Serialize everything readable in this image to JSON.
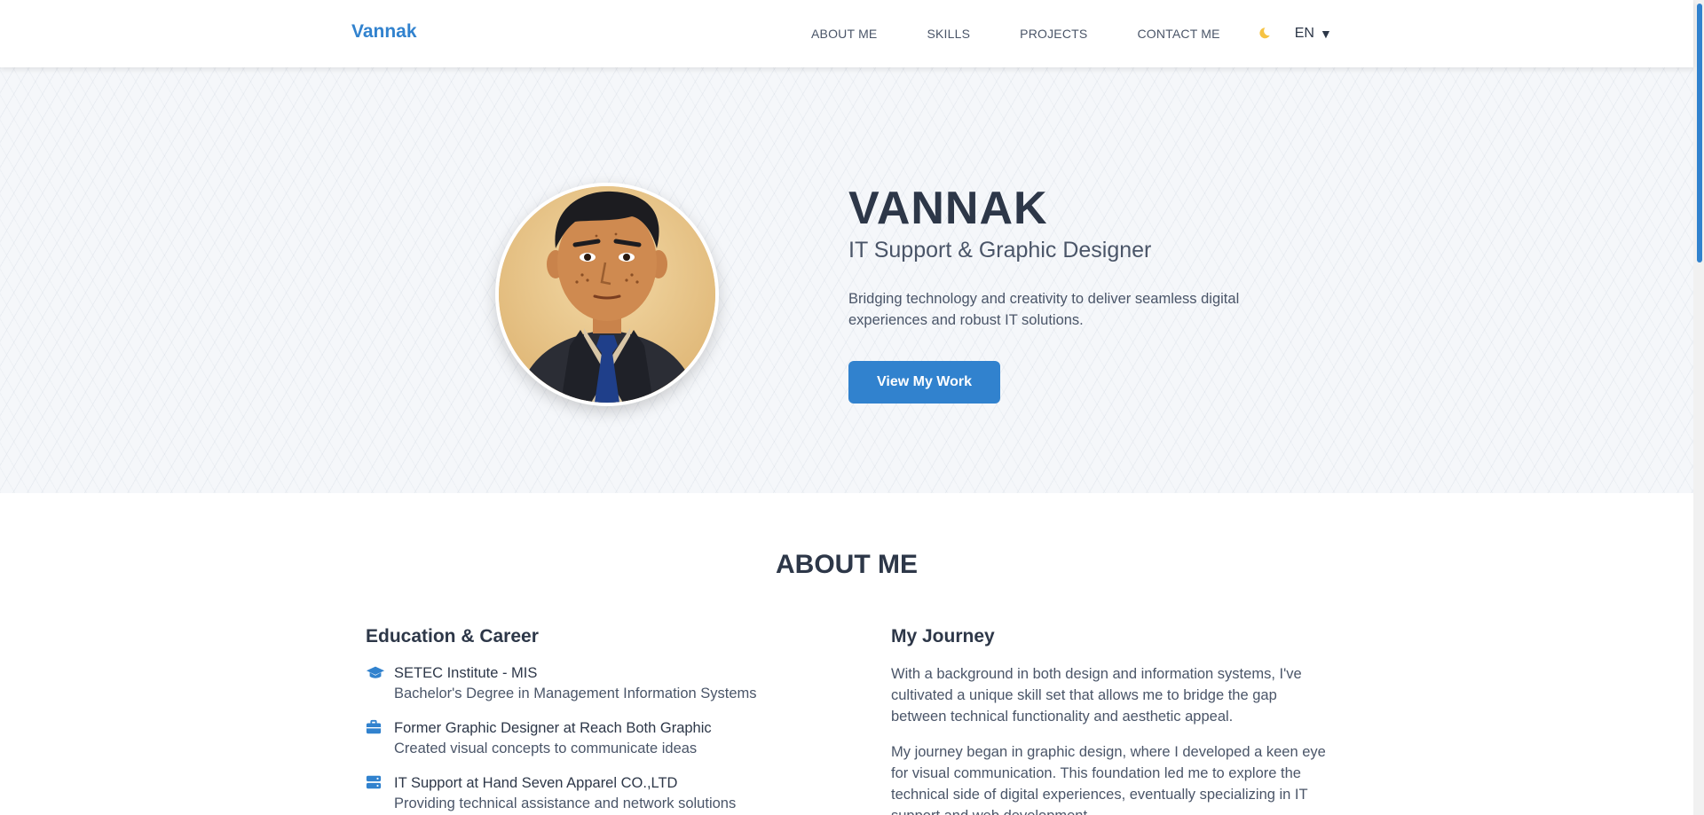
{
  "nav": {
    "brand": "Vannak",
    "links": [
      "ABOUT ME",
      "SKILLS",
      "PROJECTS",
      "CONTACT ME"
    ],
    "theme_icon": "moon-icon",
    "language": "EN",
    "language_caret": "▼"
  },
  "hero": {
    "name": "VANNAK",
    "title": "IT Support & Graphic Designer",
    "description": "Bridging technology and creativity to deliver seamless digital experiences and robust IT solutions.",
    "cta": "View My Work",
    "avatar": "avatar-illustration"
  },
  "about": {
    "title": "ABOUT ME",
    "education_heading": "Education & Career",
    "education": [
      {
        "icon": "graduation-cap-icon",
        "title": "SETEC Institute - MIS",
        "subtitle": "Bachelor's Degree in Management Information Systems"
      },
      {
        "icon": "briefcase-icon",
        "title": "Former Graphic Designer at Reach Both Graphic",
        "subtitle": "Created visual concepts to communicate ideas"
      },
      {
        "icon": "server-icon",
        "title": "IT Support at Hand Seven Apparel CO.,LTD",
        "subtitle": "Providing technical assistance and network solutions"
      }
    ],
    "journey_heading": "My Journey",
    "journey": [
      "With a background in both design and information systems, I've cultivated a unique skill set that allows me to bridge the gap between technical functionality and aesthetic appeal.",
      "My journey began in graphic design, where I developed a keen eye for visual communication. This foundation led me to explore the technical side of digital experiences, eventually specializing in IT support and web development."
    ]
  },
  "colors": {
    "accent": "#3182ce",
    "text": "#2d3748",
    "muted": "#4a5568"
  }
}
